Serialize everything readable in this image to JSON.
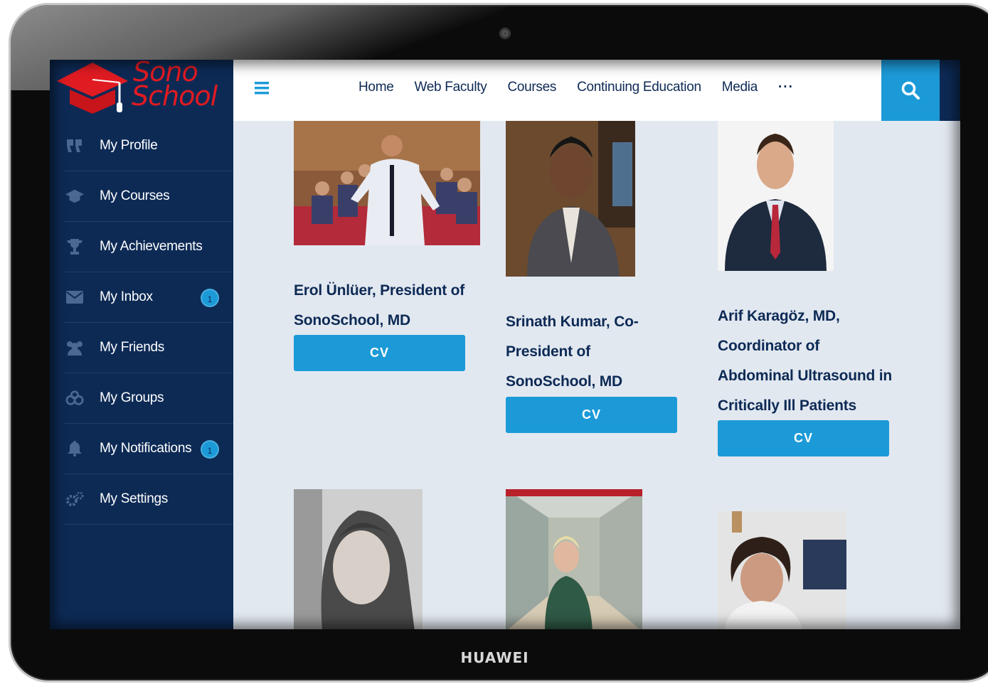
{
  "device": {
    "brand": "HUAWEI"
  },
  "logo": {
    "line1": "Sono",
    "line2": "School"
  },
  "sidebar": {
    "items": [
      {
        "label": "My Profile",
        "icon": "quote-icon"
      },
      {
        "label": "My Courses",
        "icon": "graduation-cap-icon"
      },
      {
        "label": "My Achievements",
        "icon": "trophy-icon"
      },
      {
        "label": "My Inbox",
        "icon": "envelope-icon",
        "badge": "1"
      },
      {
        "label": "My Friends",
        "icon": "users-icon"
      },
      {
        "label": "My Groups",
        "icon": "groups-icon"
      },
      {
        "label": "My Notifications",
        "icon": "bell-icon",
        "badge": "1"
      },
      {
        "label": "My Settings",
        "icon": "gears-icon"
      }
    ]
  },
  "nav": {
    "items": [
      "Home",
      "Web Faculty",
      "Courses",
      "Continuing Education",
      "Media"
    ],
    "more": "···"
  },
  "faculty": [
    {
      "name_lines": [
        "Erol Ünlüer, President of",
        "SonoSchool, MD"
      ],
      "cv": "CV"
    },
    {
      "name_lines": [
        "Srinath Kumar, Co-",
        "President of",
        "SonoSchool, MD"
      ],
      "cv": "CV"
    },
    {
      "name_lines": [
        "Arif Karagöz, MD,",
        "Coordinator of",
        "Abdominal Ultrasound in",
        "Critically Ill Patients"
      ],
      "cv": "CV"
    }
  ],
  "colors": {
    "sidebar_bg": "#0d2a55",
    "accent": "#1c9ad8",
    "logo_red": "#e11b22",
    "content_bg": "#e2e8f0"
  }
}
